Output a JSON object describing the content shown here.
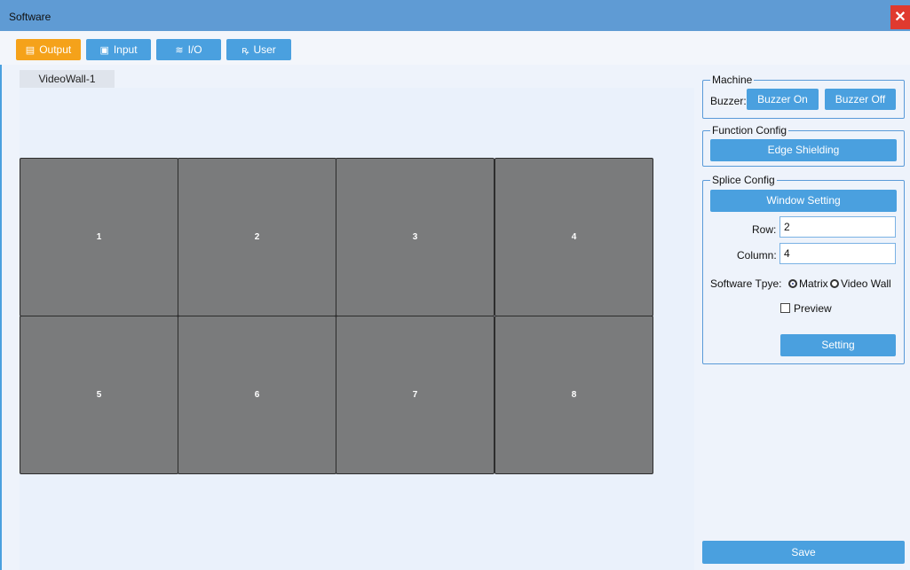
{
  "window": {
    "title": "Software",
    "close_glyph": "✕"
  },
  "toolbar": {
    "tabs": [
      {
        "label": "Output",
        "icon": "output-icon",
        "icon_glyph": "▤"
      },
      {
        "label": "Input",
        "icon": "input-icon",
        "icon_glyph": "▣"
      },
      {
        "label": "I/O",
        "icon": "io-icon",
        "icon_glyph": "≋"
      },
      {
        "label": "User",
        "icon": "user-icon",
        "icon_glyph": "ꝶ"
      }
    ]
  },
  "workspace": {
    "tab_label": "VideoWall-1",
    "screens": [
      "1",
      "2",
      "3",
      "4",
      "5",
      "6",
      "7",
      "8"
    ]
  },
  "machine": {
    "legend": "Machine",
    "buzzer_label": "Buzzer:",
    "buzzer_on": "Buzzer On",
    "buzzer_off": "Buzzer Off"
  },
  "function_config": {
    "legend": "Function Config",
    "edge_shielding": "Edge Shielding"
  },
  "splice_config": {
    "legend": "Splice Config",
    "window_setting": "Window Setting",
    "row_label": "Row:",
    "row_value": "2",
    "column_label": "Column:",
    "column_value": "4",
    "software_type_label": "Software Tpye:",
    "option_matrix": "Matrix",
    "option_video_wall": "Video Wall",
    "selected_option": "Matrix",
    "preview_label": "Preview",
    "preview_checked": false,
    "setting": "Setting"
  },
  "save_label": "Save",
  "colors": {
    "accent": "#4aa0df",
    "active_tab": "#f5a21a",
    "titlebar": "#5f9bd4",
    "close": "#e03a2f",
    "screen_tile": "#7a7b7c"
  }
}
